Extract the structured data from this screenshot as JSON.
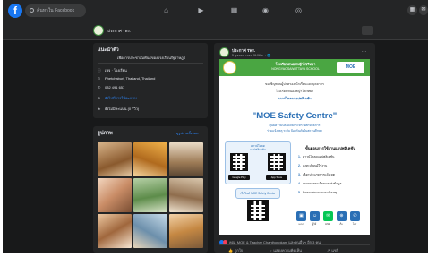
{
  "colors": {
    "background": "#18191a",
    "surface": "#242526",
    "accent": "#1877f2",
    "link": "#2d88ff",
    "poster_green": "#4aa642",
    "poster_blue": "#2a6fb5"
  },
  "topbar": {
    "search_placeholder": "ค้นหาใน Facebook",
    "nav_icons": [
      "home-icon",
      "watch-icon",
      "marketplace-icon",
      "groups-icon",
      "gaming-icon"
    ],
    "right_icons": [
      "menu-grid-icon",
      "messenger-icon"
    ]
  },
  "page_header": {
    "name": "ประกาศ รพร.",
    "more": "..."
  },
  "intro": {
    "title": "แนะนำตัว",
    "description": "เพื่อการประชาสัมพันธ์ของโรงเรียนรัฐราษฎร์",
    "rows": [
      {
        "icon": "info-icon",
        "text": "เพจ · โรงเรียน"
      },
      {
        "icon": "location-icon",
        "text": "Phetchaburi, Thailand, Thailand"
      },
      {
        "icon": "phone-icon",
        "text": "032 491 657"
      },
      {
        "icon": "globe-icon",
        "text": "ยังไม่มีการให้คะแนน",
        "link": true
      },
      {
        "icon": "star-icon",
        "text": "ยังไม่มีคะแนน (0 รีวิว)"
      }
    ]
  },
  "photos": {
    "title": "รูปภาพ",
    "see_all": "ดูรูปภาพทั้งหมด"
  },
  "post": {
    "author": "ประกาศ รพร.",
    "time": "5 ตุลาคม เวลา 09:06 น. · 🌐",
    "more": "...",
    "poster": {
      "school_th": "โรงเรียนหนองหญ้าไซวิทยา",
      "school_en": "NONGYAOSAIWITTAYA SCHOOL",
      "moe_badge": "MOE",
      "line1": "ขอเชิญชวนผู้ปกครอง นักเรียนและบุคลากร",
      "line2": "โรงเรียนหนองหญ้าไซวิทยา",
      "line3": "ดาวน์โหลดแอปพลิเคชัน",
      "title": "\"MOE Safety Centre\"",
      "sub1": "ศูนย์ความปลอดภัยกระทรวงศึกษาธิการ",
      "sub2": "ร่วมแจ้งเหตุ ระงับ ป้องกันภัยในสถานศึกษา",
      "qr_label_1": "ดาวน์โหลด",
      "qr_label_2": "แอปพลิเคชัน",
      "store_google": "Google Play",
      "store_apple": "App Store",
      "web_label": "เว็บไซต์ MOE Safety Center",
      "steps_heading": "ขั้นตอนการใช้งานแอปพลิเคชัน",
      "steps": [
        {
          "num": "1.",
          "text": "ดาวน์โหลดแอปพลิเคชัน"
        },
        {
          "num": "2.",
          "text": "ลงทะเบียนผู้ใช้งาน"
        },
        {
          "num": "3.",
          "text": "เลือกประเภทการแจ้งเหตุ"
        },
        {
          "num": "4.",
          "text": "กรอกรายละเอียดและส่งข้อมูล"
        },
        {
          "num": "5.",
          "text": "ติดตามสถานะการแจ้งเหตุ"
        }
      ],
      "bottom_icons": [
        {
          "icon": "app-icon",
          "label": "แอป",
          "color": "#2a6fb5"
        },
        {
          "icon": "user-icon",
          "label": "ผู้ใช้",
          "color": "#2a6fb5"
        },
        {
          "icon": "line-icon",
          "label": "LINE",
          "color": "#06c755"
        },
        {
          "icon": "web-icon",
          "label": "เว็บ",
          "color": "#2a6fb5"
        },
        {
          "icon": "phone-icon",
          "label": "โทร",
          "color": "#2a6fb5"
        }
      ]
    },
    "reactions_text": "คุณ, MOE & Teacher Chanthongkam และคนอื่นๆ อีก 3 คน",
    "actions": [
      {
        "icon": "like-icon",
        "label": "ถูกใจ"
      },
      {
        "icon": "comment-icon",
        "label": "แสดงความคิดเห็น"
      },
      {
        "icon": "share-icon",
        "label": "แชร์"
      }
    ]
  }
}
